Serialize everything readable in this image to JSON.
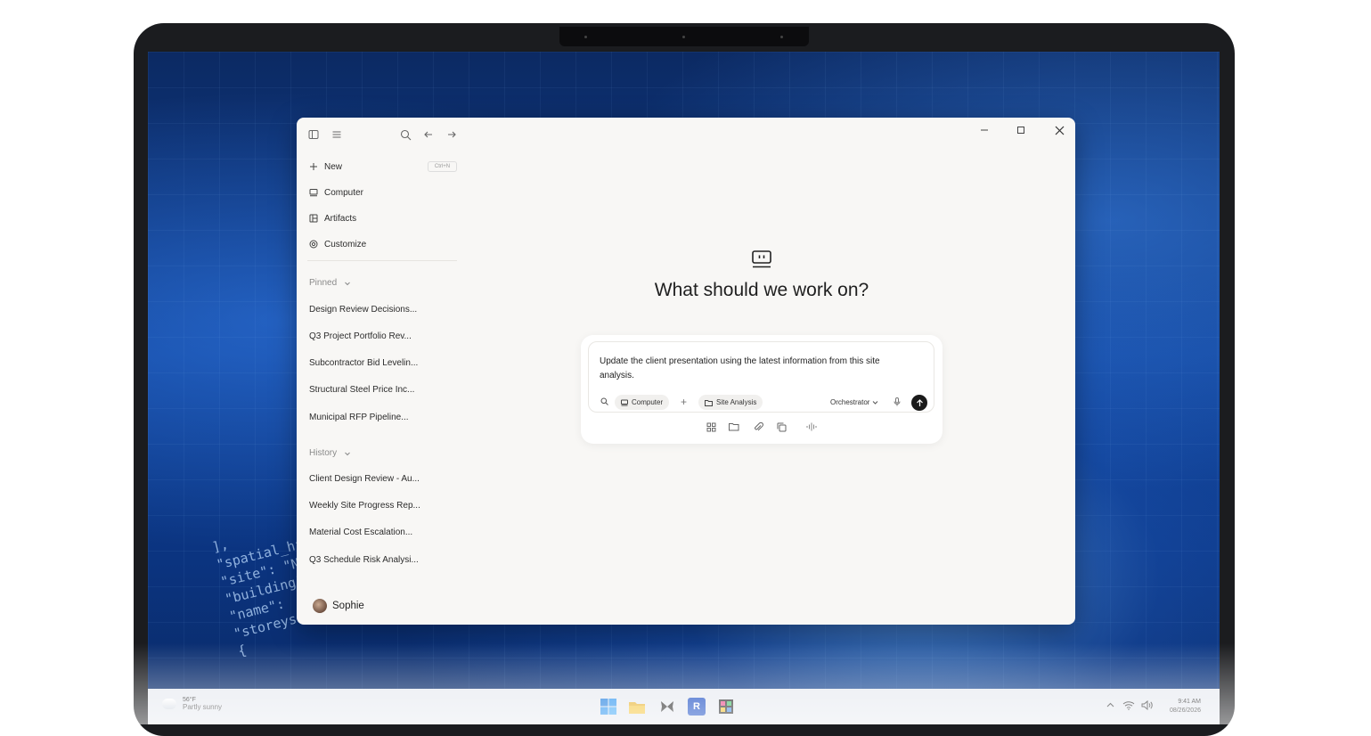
{
  "sidebar": {
    "nav": [
      {
        "label": "New",
        "icon": "plus-icon"
      },
      {
        "label": "Computer",
        "icon": "computer-icon"
      },
      {
        "label": "Artifacts",
        "icon": "artifacts-icon"
      },
      {
        "label": "Customize",
        "icon": "customize-icon"
      }
    ],
    "new_shortcut": "Ctrl+N",
    "pinned_label": "Pinned",
    "pinned": [
      "Design Review Decisions...",
      "Q3 Project Portfolio Rev...",
      "Subcontractor Bid Levelin...",
      "Structural Steel Price Inc...",
      "Municipal RFP Pipeline..."
    ],
    "history_label": "History",
    "history": [
      "Client Design Review - Au...",
      "Weekly Site Progress Rep...",
      "Material Cost Escalation...",
      "Q3 Schedule Risk Analysi..."
    ],
    "user_name": "Sophie"
  },
  "main": {
    "title": "What should we work on?",
    "prompt": "Update the client presentation using the latest information from this site analysis.",
    "chip_computer": "Computer",
    "chip_site": "Site Analysis",
    "model": "Orchestrator"
  },
  "taskbar": {
    "temp": "56°F",
    "weather": "Partly sunny",
    "time": "9:41 AM",
    "date": "08/26/2026"
  },
  "wallpaper_code": "],\n\"spatial_hier\n\"site\": \"No\n\"building\":\n\"name\":\n\"storeys\"\n{",
  "colors": {
    "accent_dark": "#1a1a1a",
    "window_bg": "#f8f7f5",
    "wallpaper_blue": "#0f3f93"
  }
}
